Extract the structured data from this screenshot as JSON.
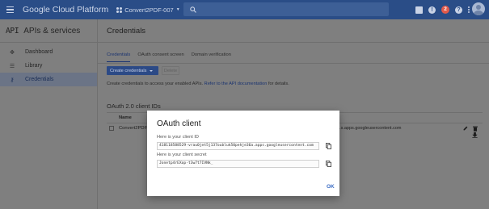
{
  "topbar": {
    "brand": "Google Cloud Platform",
    "project": "Convert2PDF-007",
    "alert_count": "!",
    "help_glyph": "?"
  },
  "sidebar": {
    "api_badge": "API",
    "title": "APIs & services",
    "items": [
      {
        "label": "Dashboard",
        "icon": "dashboard-icon",
        "active": false
      },
      {
        "label": "Library",
        "icon": "library-icon",
        "active": false
      },
      {
        "label": "Credentials",
        "icon": "key-icon",
        "active": true
      }
    ]
  },
  "main": {
    "title": "Credentials",
    "tabs": [
      "Credentials",
      "OAuth consent screen",
      "Domain verification"
    ],
    "create_button": "Create credentials",
    "delete_button": "Delete",
    "help_prefix": "Create credentials to access your enabled APIs. ",
    "help_link": "Refer to the API documentation",
    "help_suffix": " for details.",
    "section_title": "OAuth 2.0 client IDs",
    "table_header_name": "Name",
    "row": {
      "name": "Convert2PDF",
      "client_id": "...s.apps.googleusercontent.com"
    }
  },
  "dialog": {
    "title": "OAuth client",
    "client_id_label": "Here is your client ID",
    "client_id_value": "418118588529-vrau0jet5j137oubluk50pehje36a.apps.googleusercontent.com",
    "secret_label": "Here is your client secret",
    "secret_value": "Jonetp4rEXop-t3w7t7IVNk_",
    "ok_button": "OK"
  },
  "colors": {
    "topbar": "#2a4d87",
    "overlay_page": "#7f7f7f",
    "primary_button": "#2c4a86",
    "link": "#3b6cc4"
  }
}
